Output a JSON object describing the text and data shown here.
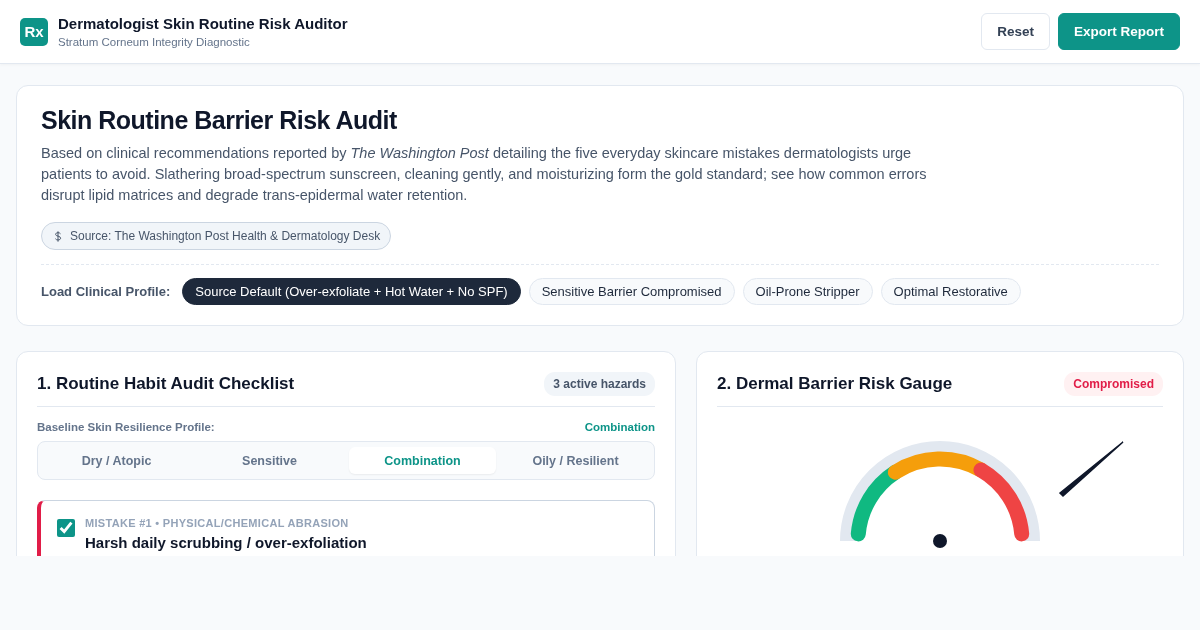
{
  "header": {
    "logo": "Rx",
    "title": "Dermatologist Skin Routine Risk Auditor",
    "subtitle": "Stratum Corneum Integrity Diagnostic",
    "buttons": [
      {
        "label": "Reset",
        "kind": "secondary"
      },
      {
        "label": "Export Report",
        "kind": "primary"
      }
    ]
  },
  "intro": {
    "title": "Skin Routine Barrier Risk Audit",
    "description": "Based on clinical recommendations reported by *The Washington Post* detailing the five everyday skincare mistakes dermatologists urge patients to avoid. Slathering broad-spectrum sunscreen, cleaning gently, and moisturizing form the gold standard; see how common errors disrupt lipid matrices and degrade trans-epidermal water retention.",
    "source": "Source: The Washington Post Health & Dermatology Desk",
    "profile_label": "Load Clinical Profile:",
    "profiles": [
      {
        "label": "Source Default (Over-exfoliate + Hot Water + No SPF)",
        "selected": true
      },
      {
        "label": "Sensitive Barrier Compromised",
        "selected": false
      },
      {
        "label": "Oil-Prone Stripper",
        "selected": false
      },
      {
        "label": "Optimal Restorative",
        "selected": false
      }
    ]
  },
  "checklist": {
    "title": "1. Routine Habit Audit Checklist",
    "badge": "3 active hazards",
    "baseline_label": "Baseline Skin Resilience Profile:",
    "baseline_value": "Combination",
    "skin_types": [
      {
        "label": "Dry / Atopic",
        "selected": false
      },
      {
        "label": "Sensitive",
        "selected": false
      },
      {
        "label": "Combination",
        "selected": true
      },
      {
        "label": "Oily / Resilient",
        "selected": false
      }
    ],
    "mistakes": [
      {
        "tag": "MISTAKE #1 • PHYSICAL/CHEMICAL ABRASION",
        "title": "Harsh daily scrubbing / over-exfoliation",
        "checked": true
      }
    ]
  },
  "gauge": {
    "title": "2. Dermal Barrier Risk Gauge",
    "status": "Compromised"
  }
}
